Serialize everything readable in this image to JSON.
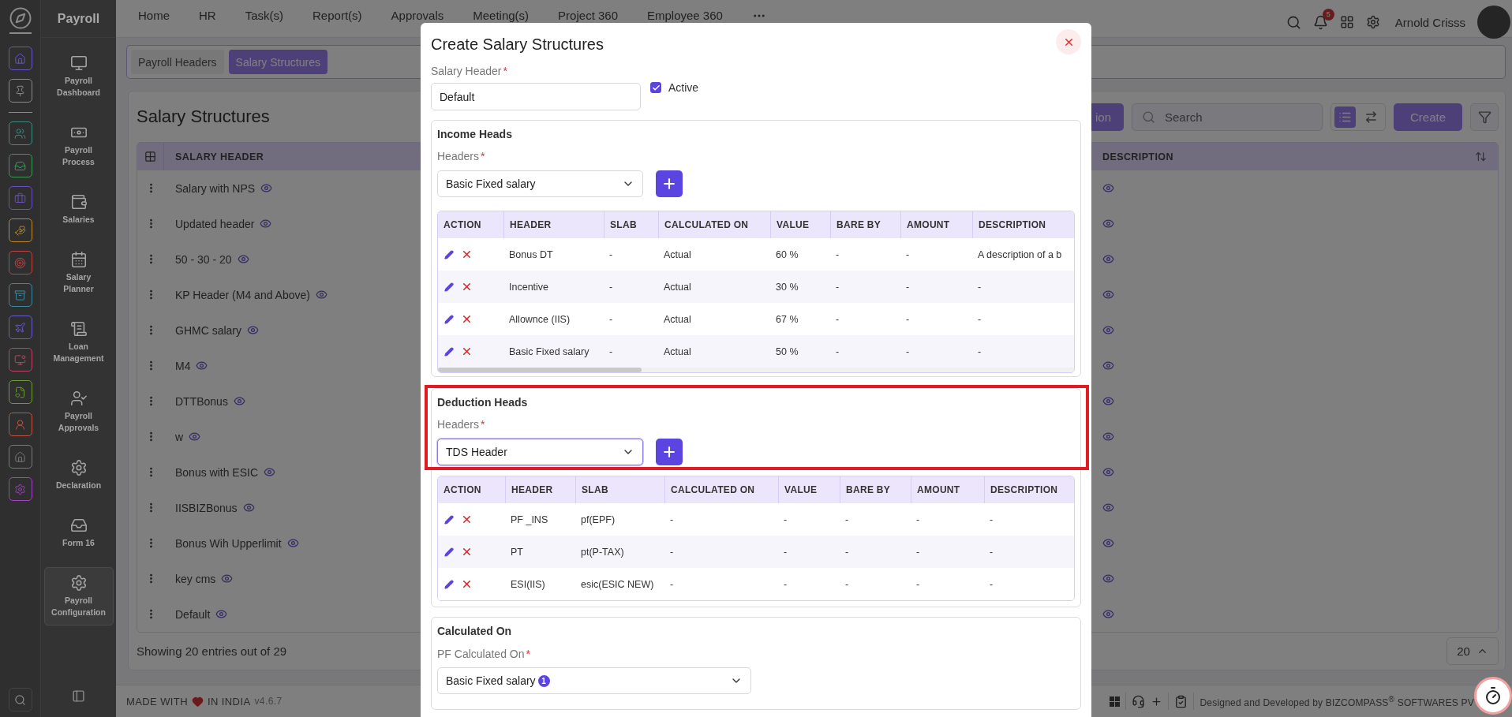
{
  "rail": {
    "items": [
      {
        "color": "#6b55c9"
      },
      {
        "color": "#8a8a8a"
      },
      {
        "color": "#3f8c82"
      },
      {
        "color": "#3f9a55"
      },
      {
        "color": "#6b4fc0"
      },
      {
        "color": "#c08a2a"
      },
      {
        "color": "#c0443e"
      },
      {
        "color": "#3b8aa0"
      },
      {
        "color": "#6a5fc8"
      },
      {
        "color": "#c04468"
      },
      {
        "color": "#6c9c34"
      },
      {
        "color": "#c05540"
      },
      {
        "color": "#7a7a7a"
      },
      {
        "color": "#a640c4"
      }
    ]
  },
  "module": {
    "title": "Payroll",
    "items": [
      {
        "label": "Payroll Dashboard",
        "selected": false
      },
      {
        "label": "Payroll Process",
        "selected": false
      },
      {
        "label": "Salaries",
        "selected": false
      },
      {
        "label": "Salary Planner",
        "selected": false
      },
      {
        "label": "Loan Management",
        "selected": false
      },
      {
        "label": "Payroll Approvals",
        "selected": false
      },
      {
        "label": "Declaration",
        "selected": false
      },
      {
        "label": "Form 16",
        "selected": false
      },
      {
        "label": "Payroll Configuration",
        "selected": true
      }
    ]
  },
  "topnav": {
    "items": [
      "Home",
      "HR",
      "Task(s)",
      "Report(s)",
      "Approvals",
      "Meeting(s)",
      "Project 360",
      "Employee 360"
    ],
    "notifications": "5",
    "user": "Arnold Crisss"
  },
  "tabs": [
    {
      "label": "Payroll Headers",
      "selected": false
    },
    {
      "label": "Salary Structures",
      "selected": true
    }
  ],
  "page": {
    "title": "Salary Structures",
    "partial_button": "ion",
    "search_placeholder": "Search",
    "views": [
      {
        "selected": true
      },
      {
        "selected": false
      }
    ],
    "create": "Create"
  },
  "list": {
    "columns": [
      "SALARY HEADER",
      "DESCRIPTION"
    ],
    "rows": [
      "Salary with NPS",
      "Updated header",
      "50 - 30 - 20",
      "KP Header (M4 and Above)",
      "GHMC salary",
      "M4",
      "DTTBonus",
      "w",
      "Bonus with ESIC",
      "IISBIZBonus",
      "Bonus Wih Upperlimit",
      "key cms",
      "Default"
    ],
    "info": "Showing 20 entries out of 29",
    "page_size": "20"
  },
  "footer": {
    "made_with": "MADE WITH",
    "in_india": "IN INDIA",
    "version": "v4.6.7",
    "credit": "Designed and Developed by BIZCOMPASS$^{®}$ SOFTWARES PV"
  },
  "modal": {
    "title": "Create Salary Structures",
    "salary_header": {
      "label": "Salary Header",
      "mark": "*",
      "value": "Default"
    },
    "active": {
      "label": "Active",
      "checked": true
    },
    "sections": [
      {
        "title": "Income Heads",
        "highlighted": false,
        "headers": {
          "label": "Headers",
          "mark": "*",
          "value": "Basic Fixed salary",
          "focused": false
        },
        "columns": [
          "ACTION",
          "HEADER",
          "SLAB",
          "CALCULATED ON",
          "VALUE",
          "BARE BY",
          "AMOUNT",
          "DESCRIPTION"
        ],
        "rows": [
          [
            "",
            "Bonus DT",
            "-",
            "Actual",
            "60 %",
            "-",
            "-",
            "A description of a b"
          ],
          [
            "",
            "Incentive",
            "-",
            "Actual",
            "30 %",
            "-",
            "-",
            "-"
          ],
          [
            "",
            "Allownce (IIS)",
            "-",
            "Actual",
            "67 %",
            "-",
            "-",
            "-"
          ],
          [
            "",
            "Basic Fixed salary",
            "-",
            "Actual",
            "50 %",
            "-",
            "-",
            "-"
          ]
        ]
      },
      {
        "title": "Deduction Heads",
        "highlighted": true,
        "headers": {
          "label": "Headers",
          "mark": "*",
          "value": "TDS Header",
          "focused": true
        },
        "columns": [
          "ACTION",
          "HEADER",
          "SLAB",
          "CALCULATED ON",
          "VALUE",
          "BARE BY",
          "AMOUNT",
          "DESCRIPTION"
        ],
        "rows": [
          [
            "",
            "PF _INS",
            "pf(EPF)",
            "-",
            "-",
            "-",
            "-",
            "-"
          ],
          [
            "",
            "PT",
            "pt(P-TAX)",
            "-",
            "-",
            "-",
            "-",
            "-"
          ],
          [
            "",
            "ESI(IIS)",
            "esic(ESIC NEW)",
            "-",
            "-",
            "-",
            "-",
            "-"
          ]
        ]
      }
    ],
    "calculated_on": {
      "title": "Calculated On",
      "label": "PF Calculated On",
      "mark": "*",
      "value": "Basic Fixed salary",
      "count": "1"
    }
  }
}
